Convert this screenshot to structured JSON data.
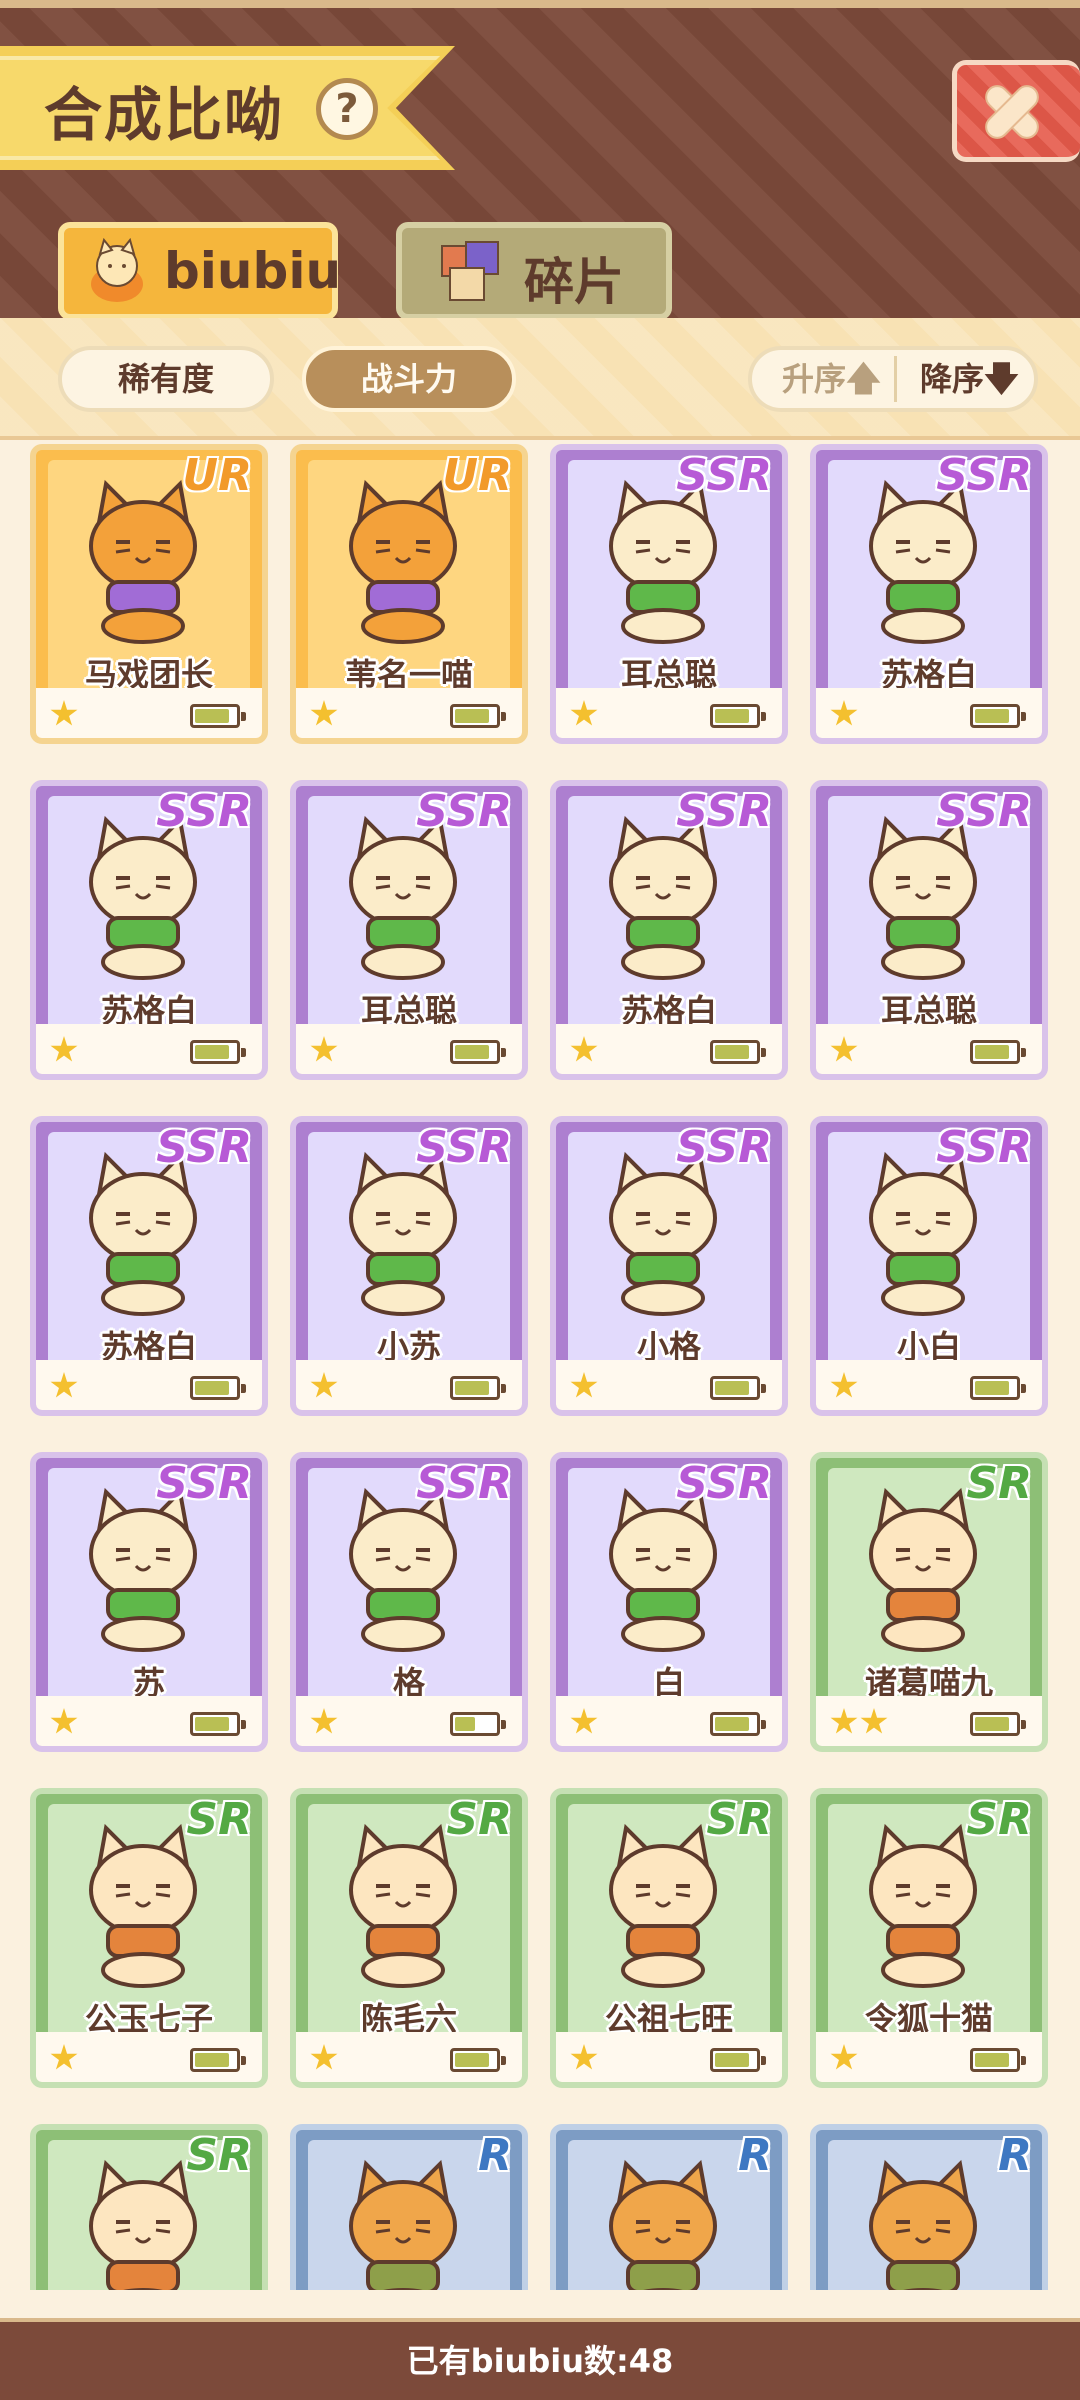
{
  "header": {
    "title": "合成比呦",
    "help_icon": "?",
    "close_icon": "close-icon"
  },
  "tabs": [
    {
      "label": "biubiu",
      "active": true,
      "icon": "cat-icon"
    },
    {
      "label": "碎片",
      "active": false,
      "icon": "fragment-icon"
    }
  ],
  "sort": {
    "rarity_label": "稀有度",
    "power_label": "战斗力",
    "power_active": true,
    "asc_label": "升序",
    "desc_label": "降序",
    "asc_arrow": "🡅",
    "desc_arrow": "🡇"
  },
  "cards": [
    {
      "name": "马戏团长",
      "rarity": "UR",
      "stars": 1,
      "battery": 0.85
    },
    {
      "name": "苇名一喵",
      "rarity": "UR",
      "stars": 1,
      "battery": 0.85
    },
    {
      "name": "耳总聪",
      "rarity": "SSR",
      "stars": 1,
      "battery": 0.85
    },
    {
      "name": "苏格白",
      "rarity": "SSR",
      "stars": 1,
      "battery": 0.85
    },
    {
      "name": "苏格白",
      "rarity": "SSR",
      "stars": 1,
      "battery": 0.85
    },
    {
      "name": "耳总聪",
      "rarity": "SSR",
      "stars": 1,
      "battery": 0.85
    },
    {
      "name": "苏格白",
      "rarity": "SSR",
      "stars": 1,
      "battery": 0.85
    },
    {
      "name": "耳总聪",
      "rarity": "SSR",
      "stars": 1,
      "battery": 0.85
    },
    {
      "name": "苏格白",
      "rarity": "SSR",
      "stars": 1,
      "battery": 0.85
    },
    {
      "name": "小苏",
      "rarity": "SSR",
      "stars": 1,
      "battery": 0.85
    },
    {
      "name": "小格",
      "rarity": "SSR",
      "stars": 1,
      "battery": 0.85
    },
    {
      "name": "小白",
      "rarity": "SSR",
      "stars": 1,
      "battery": 0.85
    },
    {
      "name": "苏",
      "rarity": "SSR",
      "stars": 1,
      "battery": 0.85
    },
    {
      "name": "格",
      "rarity": "SSR",
      "stars": 1,
      "battery": 0.5
    },
    {
      "name": "白",
      "rarity": "SSR",
      "stars": 1,
      "battery": 0.85
    },
    {
      "name": "诸葛喵九",
      "rarity": "SR",
      "stars": 2,
      "battery": 0.85
    },
    {
      "name": "公玉七子",
      "rarity": "SR",
      "stars": 1,
      "battery": 0.85
    },
    {
      "name": "陈毛六",
      "rarity": "SR",
      "stars": 1,
      "battery": 0.85
    },
    {
      "name": "公祖七旺",
      "rarity": "SR",
      "stars": 1,
      "battery": 0.85
    },
    {
      "name": "令狐十猫",
      "rarity": "SR",
      "stars": 1,
      "battery": 0.85
    },
    {
      "name": "",
      "rarity": "SR",
      "stars": 1,
      "battery": 0.85
    },
    {
      "name": "",
      "rarity": "R",
      "stars": 1,
      "battery": 0.85
    },
    {
      "name": "",
      "rarity": "R",
      "stars": 1,
      "battery": 0.85
    },
    {
      "name": "",
      "rarity": "R",
      "stars": 1,
      "battery": 0.85
    }
  ],
  "footer": {
    "count_text": "已有biubiu数:48"
  }
}
